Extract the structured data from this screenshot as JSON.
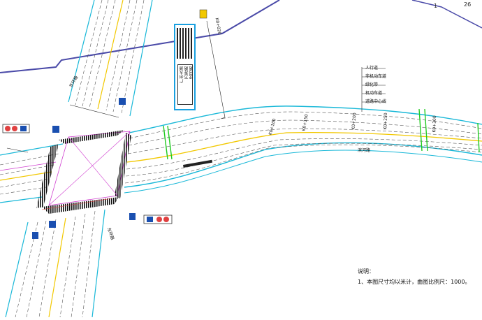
{
  "sheet": {
    "number_left": "1",
    "number_right": "26"
  },
  "notes": {
    "heading": "说明：",
    "line1": "1、本图尺寸均以米计，曲图比例尺：1000。"
  },
  "cross_section_legend": [
    "人行道",
    "非机动车道",
    "绿化带",
    "机动车道",
    "道路中心线"
  ],
  "road_names": {
    "main_road": "滨河路",
    "north_road": "东环路",
    "south_road": "东环路"
  },
  "stations": [
    "K0+100",
    "K0+150",
    "K0+200",
    "K0+250",
    "K0+300"
  ],
  "junction_station": "K0+020",
  "sign_text": {
    "line1": "广州大道",
    "line2": "万寿路",
    "line3": "滨河路"
  },
  "colors": {
    "road_edge": "#19b8d8",
    "centerline": "#f2c800",
    "boundary": "#4a4aa8",
    "crosswalk": "#111111",
    "green_marker": "#22cc22",
    "magenta": "#d040d0",
    "red_line": "#e04040",
    "sign_frame": "#19a0e0"
  }
}
